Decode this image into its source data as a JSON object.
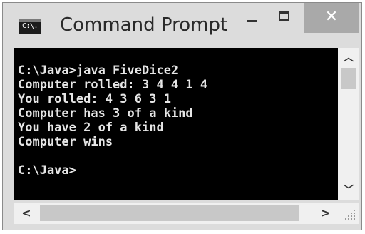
{
  "window": {
    "title": "Command Prompt",
    "icon": "command-prompt-icon",
    "icon_text": "C:\\."
  },
  "controls": {
    "minimize_icon": "minimize-icon",
    "maximize_icon": "maximize-icon",
    "close_glyph": "✕",
    "close_icon": "close-icon"
  },
  "console": {
    "lines": [
      "C:\\Java>java FiveDice2",
      "Computer rolled: 3 4 4 1 4",
      "You rolled: 4 3 6 3 1",
      "Computer has 3 of a kind",
      "You have 2 of a kind",
      "Computer wins",
      "",
      "C:\\Java>"
    ]
  },
  "scrollbars": {
    "up_glyph": "︿",
    "down_glyph": "﹀",
    "left_glyph": "<",
    "right_glyph": ">"
  },
  "colors": {
    "console_background": "#000000",
    "console_text": "#e6e6e6",
    "titlebar": "#dcdcdc",
    "close_button": "#a9a9a9"
  }
}
